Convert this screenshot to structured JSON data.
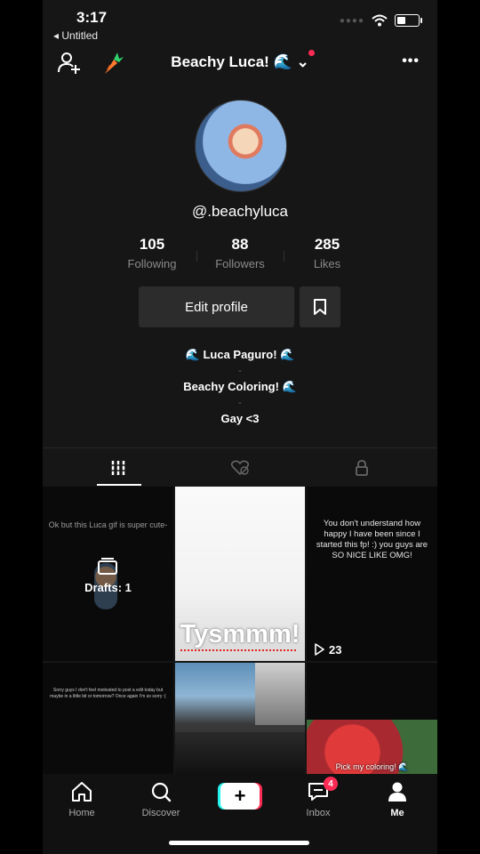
{
  "status_bar": {
    "time": "3:17",
    "back_app": "◂ Untitled"
  },
  "header": {
    "title": "Beachy Luca! 🌊 ⌄",
    "more": "•••"
  },
  "profile": {
    "username": "@.beachyluca",
    "stats": [
      {
        "value": "105",
        "label": "Following"
      },
      {
        "value": "88",
        "label": "Followers"
      },
      {
        "value": "285",
        "label": "Likes"
      }
    ],
    "edit_label": "Edit profile",
    "bio": [
      "🌊 Luca Paguro! 🌊",
      "-",
      "Beachy Coloring! 🌊",
      "-",
      "Gay <3"
    ]
  },
  "grid": {
    "tile1_text": "Ok but this Luca gif is super cute-",
    "drafts_label": "Drafts: 1",
    "tile2_caption": "Tysmmm!",
    "tile3_text": "You don't understand how happy I have been since I started this fp! :) you guys are SO NICE LIKE OMG!",
    "tile3_views": "23",
    "tile4_text": "Sorry guys I don't feel motivated to post a edit today but maybe in a little bit or tomorrow? Once again I'm so sorry :(",
    "tile6_caption": "Pick my coloring! 🌊"
  },
  "nav": {
    "home": "Home",
    "discover": "Discover",
    "inbox": "Inbox",
    "inbox_badge": "4",
    "me": "Me",
    "plus": "+"
  },
  "colors": {
    "accent_red": "#fe2c55",
    "accent_cyan": "#25f4ee",
    "bg": "#161616"
  }
}
